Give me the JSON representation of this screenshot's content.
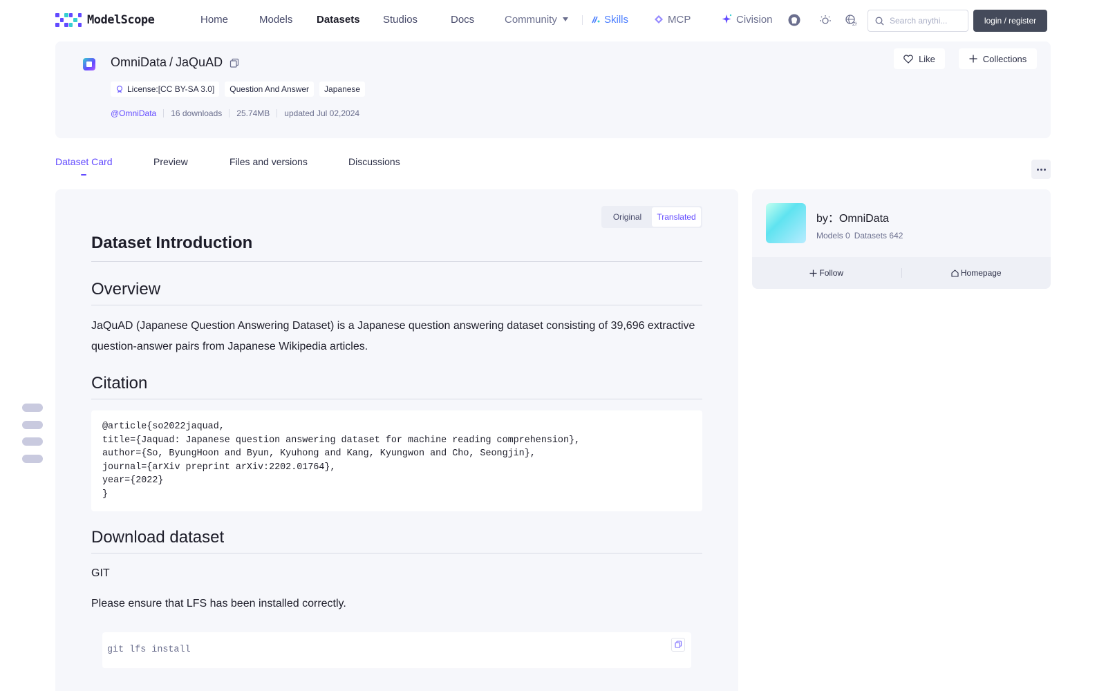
{
  "nav": {
    "logo_text": "ModelScope",
    "items": [
      {
        "label": "Home"
      },
      {
        "label": "Models"
      },
      {
        "label": "Datasets"
      },
      {
        "label": "Studios"
      },
      {
        "label": "Docs"
      },
      {
        "label": "Community"
      }
    ],
    "skills_label": "Skills",
    "mcp_label": "MCP",
    "civision_label": "Civision",
    "search_placeholder": "Search anythi...",
    "login_label": "login / register",
    "active_item": "Datasets",
    "accent_color": "#624aff"
  },
  "dataset": {
    "owner": "OmniData",
    "separator": "/",
    "name": "JaQuAD",
    "tags": [
      {
        "label": "License:[CC BY-SA 3.0]",
        "icon": "license-icon"
      },
      {
        "label": "Question And Answer"
      },
      {
        "label": "Japanese"
      }
    ],
    "author_handle": "@OmniData",
    "downloads": "16 downloads",
    "size": "25.74MB",
    "updated": "updated Jul 02,2024",
    "like_label": "Like",
    "collections_label": "Collections"
  },
  "tabs": [
    {
      "label": "Dataset Card",
      "active": true
    },
    {
      "label": "Preview"
    },
    {
      "label": "Files and versions"
    },
    {
      "label": "Discussions"
    }
  ],
  "card": {
    "toggle_original": "Original",
    "toggle_translated": "Translated",
    "selected_toggle": "Translated",
    "intro_heading": "Dataset Introduction",
    "overview_heading": "Overview",
    "overview_text": "JaQuAD (Japanese Question Answering Dataset) is a Japanese question answering dataset consisting of 39,696 extractive question-answer pairs from Japanese Wikipedia articles.",
    "citation_heading": "Citation",
    "citation_code": "@article{so2022jaquad,\ntitle={Jaquad: Japanese question answering dataset for machine reading comprehension},\nauthor={So, ByungHoon and Byun, Kyuhong and Kang, Kyungwon and Cho, Seongjin},\njournal={arXiv preprint arXiv:2202.01764},\nyear={2022}\n}",
    "download_heading": "Download dataset",
    "git_label": "GIT",
    "lfs_note": "Please ensure that LFS has been installed correctly.",
    "git_command": "git lfs install"
  },
  "org": {
    "by_label": "by：OmniData",
    "models": "Models 0",
    "datasets": "Datasets 642",
    "follow_label": "Follow",
    "homepage_label": "Homepage"
  }
}
